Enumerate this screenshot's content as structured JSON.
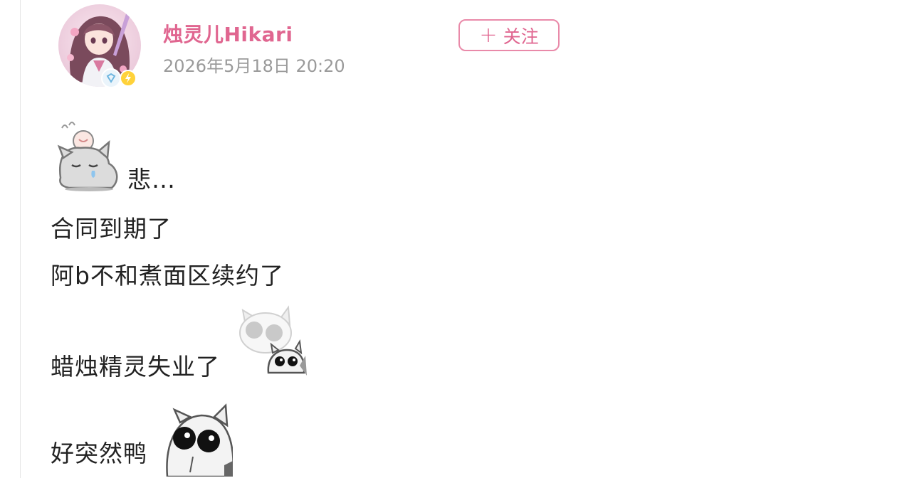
{
  "post": {
    "author": {
      "name": "烛灵儿Hikari",
      "avatar": "anime-girl-avatar",
      "badges": [
        "vip-icon",
        "bolt-icon"
      ]
    },
    "timestamp": "2026年5月18日 20:20",
    "follow_button": {
      "icon": "plus-icon",
      "label": "关注"
    },
    "lines": [
      {
        "text": "悲…",
        "sticker": "sad-cat-sticker"
      },
      {
        "text": "合同到期了"
      },
      {
        "text": "阿b不和煮面区续约了"
      },
      {
        "text": "蜡烛精灵失业了",
        "sticker": "shocked-cats-sticker"
      },
      {
        "text": "好突然鸭",
        "sticker": "wide-eyed-cat-sticker"
      }
    ]
  },
  "colors": {
    "accent": "#e06690",
    "follow_border": "#e98aa9",
    "timestamp": "#9a9a9a",
    "text": "#222222"
  }
}
